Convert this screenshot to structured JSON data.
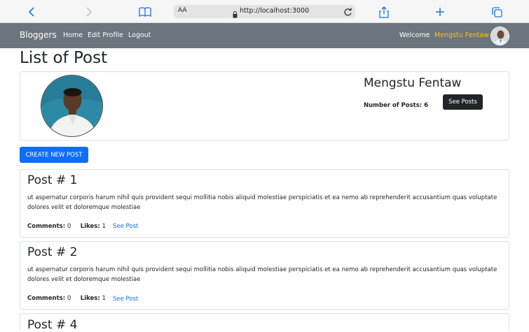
{
  "browser": {
    "aa_label": "AA",
    "url": "http://localhost:3000"
  },
  "nav": {
    "brand": "Bloggers",
    "links": [
      "Home",
      "Edit Profile",
      "Logout"
    ],
    "welcome": "Welcome",
    "user_name": "Mengstu Fentaw"
  },
  "page": {
    "title": "List of Post"
  },
  "profile": {
    "name": "Mengstu Fentaw",
    "posts_label": "Number of Posts: 6",
    "see_posts": "See Posts"
  },
  "create_button": "CREATE NEW POST",
  "posts": [
    {
      "title": "Post # 1",
      "body": "ut aspernatur corporis harum nihil quis provident sequi mollitia nobis aliquid molestiae perspiciatis et ea nemo ab reprehenderit accusantium quas voluptate dolores velit et doloremque molestiae",
      "comments_label": "Comments:",
      "comments": "0",
      "likes_label": "Likes:",
      "likes": "1",
      "see_post": "See Post"
    },
    {
      "title": "Post # 2",
      "body": "ut aspernatur corporis harum nihil quis provident sequi mollitia nobis aliquid molestiae perspiciatis et ea nemo ab reprehenderit accusantium quas voluptate dolores velit et doloremque molestiae",
      "comments_label": "Comments:",
      "comments": "0",
      "likes_label": "Likes:",
      "likes": "1",
      "see_post": "See Post"
    },
    {
      "title": "Post # 4"
    }
  ],
  "colors": {
    "nav_bg": "#6c757d",
    "accent_yellow": "#ffc107",
    "primary_blue": "#0d6efd",
    "dark_button": "#212529"
  }
}
